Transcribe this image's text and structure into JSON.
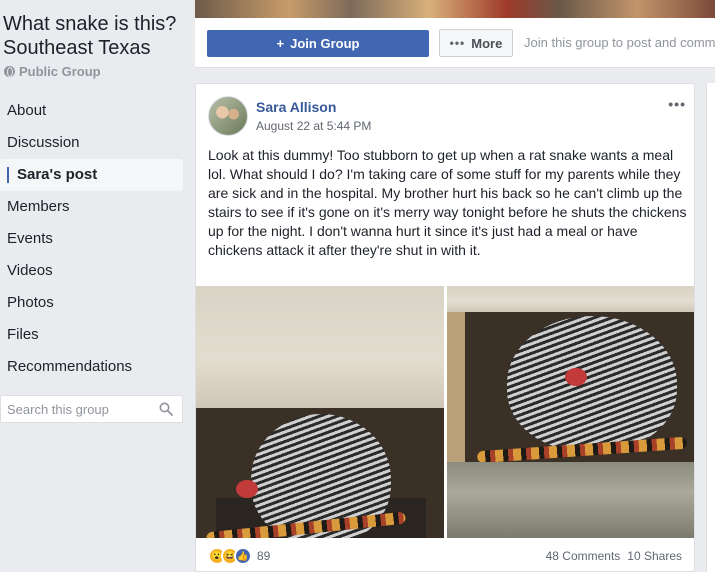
{
  "group": {
    "title": "What snake is this? Southeast Texas",
    "privacy": "Public Group"
  },
  "sidebar": {
    "items": [
      {
        "label": "About"
      },
      {
        "label": "Discussion"
      },
      {
        "label": "Sara's post"
      },
      {
        "label": "Members"
      },
      {
        "label": "Events"
      },
      {
        "label": "Videos"
      },
      {
        "label": "Photos"
      },
      {
        "label": "Files"
      },
      {
        "label": "Recommendations"
      }
    ],
    "active_index": 2,
    "search_placeholder": "Search this group"
  },
  "actions": {
    "join_label": "Join Group",
    "more_label": "More",
    "join_hint": "Join this group to post and comment"
  },
  "post": {
    "author": "Sara Allison",
    "timestamp": "August 22 at 5:44 PM",
    "text": "Look at this dummy! Too stubborn to get up when a rat snake wants a meal lol. What should I do? I'm taking care of some stuff for my parents while they are sick and in the hospital. My brother hurt his back so he can't climb up the stairs to see if it's gone on it's merry way tonight before he shuts the chickens up for the night. I don't wanna hurt it since it's just had a meal or have chickens attack it after they're shut in with it.",
    "reaction_count": "89",
    "comments": "48 Comments",
    "shares": "10 Shares"
  },
  "colors": {
    "accent": "#4267b2",
    "link": "#365899",
    "page_bg": "#e9ebee"
  }
}
